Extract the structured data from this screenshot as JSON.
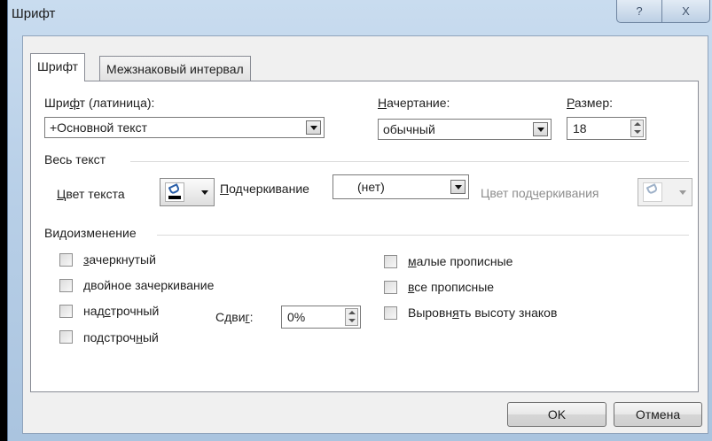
{
  "window": {
    "title": "Шрифт",
    "help_glyph": "?",
    "close_glyph": "X"
  },
  "tabs": [
    {
      "label": "Шрифт",
      "active": true
    },
    {
      "label": "Межзнаковый интервал",
      "active": false
    }
  ],
  "font": {
    "latin_label_pre": "Шри",
    "latin_label_ul": "ф",
    "latin_label_post": "т (латиница):",
    "latin_value": "+Основной текст",
    "style_label_ul": "Н",
    "style_label_post": "ачертание:",
    "style_value": "обычный",
    "size_label_ul": "Р",
    "size_label_post": "азмер:",
    "size_value": "18"
  },
  "all_text": {
    "section_label": "Весь текст",
    "color_label_ul": "Ц",
    "color_label_post": "вет текста",
    "underline_label_ul": "П",
    "underline_label_post": "одчеркивание",
    "underline_value": "(нет)",
    "underline_color_label_pre": "Цвет под",
    "underline_color_label_ul": "ч",
    "underline_color_label_post": "еркивания",
    "text_color": "#000000"
  },
  "effects": {
    "section_label": "Видоизменение",
    "strikethrough": {
      "ul": "з",
      "post": "ачеркнутый",
      "checked": false
    },
    "double_strike": {
      "ul": "д",
      "post": "войное зачеркивание",
      "checked": false
    },
    "superscript": {
      "pre": "над",
      "ul": "с",
      "post": "трочный",
      "checked": false
    },
    "subscript": {
      "pre": "подстроч",
      "ul": "н",
      "post": "ый",
      "checked": false
    },
    "offset_label_pre": "Сдви",
    "offset_label_ul": "г",
    "offset_label_post": ":",
    "offset_value": "0%",
    "small_caps": {
      "ul": "м",
      "post": "алые прописные",
      "checked": false
    },
    "all_caps": {
      "ul": "в",
      "post": "се прописные",
      "checked": false
    },
    "equalize": {
      "pre": "Выровн",
      "ul": "я",
      "post": "ть высоту знаков",
      "checked": false
    }
  },
  "buttons": {
    "ok": "OK",
    "cancel": "Отмена"
  }
}
